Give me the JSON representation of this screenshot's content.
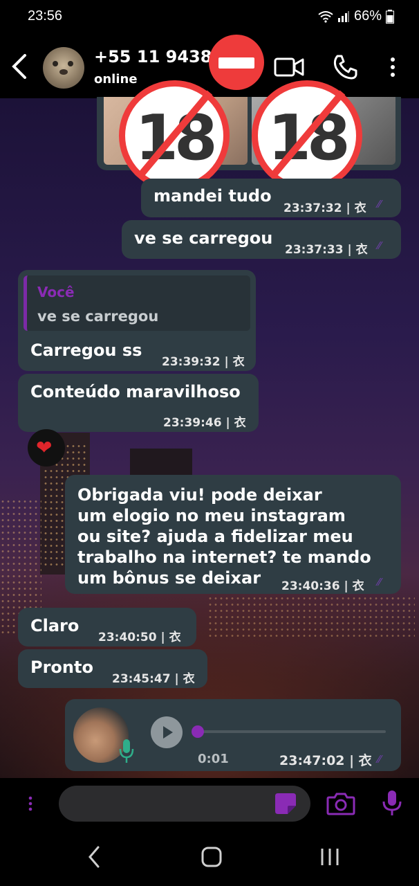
{
  "status_bar": {
    "time": "23:56",
    "battery": "66%"
  },
  "header": {
    "contact_name": "+55 11 94383",
    "contact_status": "online"
  },
  "messages": [
    {
      "text": "mandei tudo",
      "time": "23:37:32 | 衣"
    },
    {
      "text": "ve se carregou",
      "time": "23:37:33 | 衣"
    },
    {
      "quote_author": "Você",
      "quote_text": "ve se carregou",
      "text": "Carregou ss",
      "time": "23:39:32 | 衣"
    },
    {
      "text": "Conteúdo maravilhoso",
      "time": "23:39:46 | 衣"
    },
    {
      "lines": [
        "Obrigada viu! pode deixar",
        "um elogio no meu instagram",
        "ou site? ajuda a fidelizar meu",
        "trabalho na internet? te mando",
        "um bônus se deixar"
      ],
      "time": "23:40:36 | 衣"
    },
    {
      "text": "Claro",
      "time": "23:40:50 | 衣"
    },
    {
      "text": "Pronto",
      "time": "23:45:47 | 衣"
    }
  ],
  "voice_message": {
    "duration": "0:01",
    "time": "23:47:02 | 衣",
    "progress": 0
  },
  "sticker": {
    "label": "18"
  },
  "reaction": {
    "emoji": "❤"
  },
  "colors": {
    "bubble": "#2f3d44",
    "accent": "#8a2bb5",
    "badge_red": "#ee3b3b"
  }
}
